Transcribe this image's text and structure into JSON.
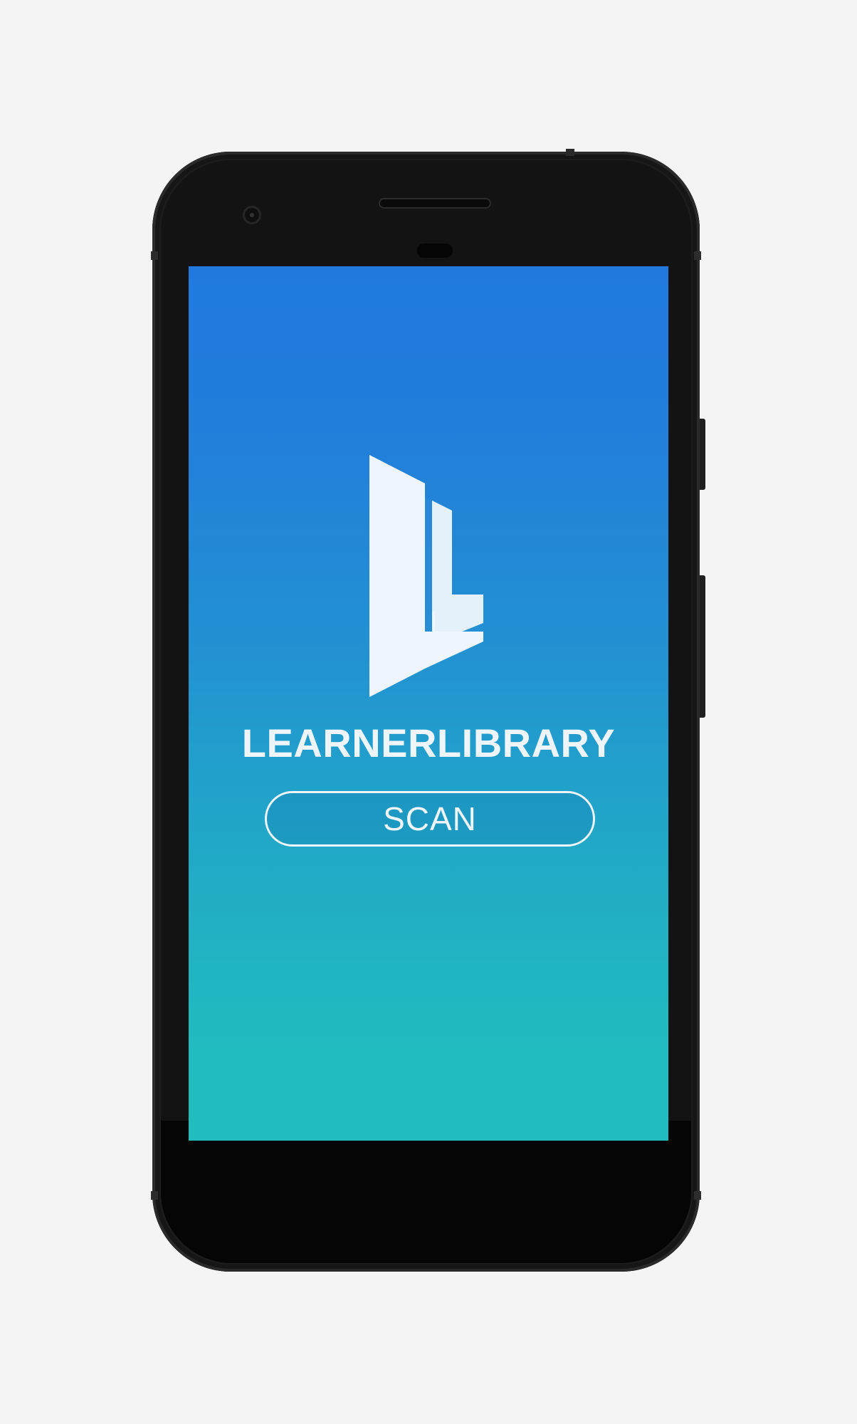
{
  "app": {
    "brand_name": "LEARNERLIBRARY",
    "logo_icon": "learner-library-logo-icon"
  },
  "actions": {
    "scan_label": "SCAN"
  },
  "colors": {
    "gradient_top": "#2179de",
    "gradient_bottom": "#21bdbe",
    "foreground": "#eef6fb",
    "device_body": "#1c1c1c",
    "page_background": "#f4f4f4"
  }
}
